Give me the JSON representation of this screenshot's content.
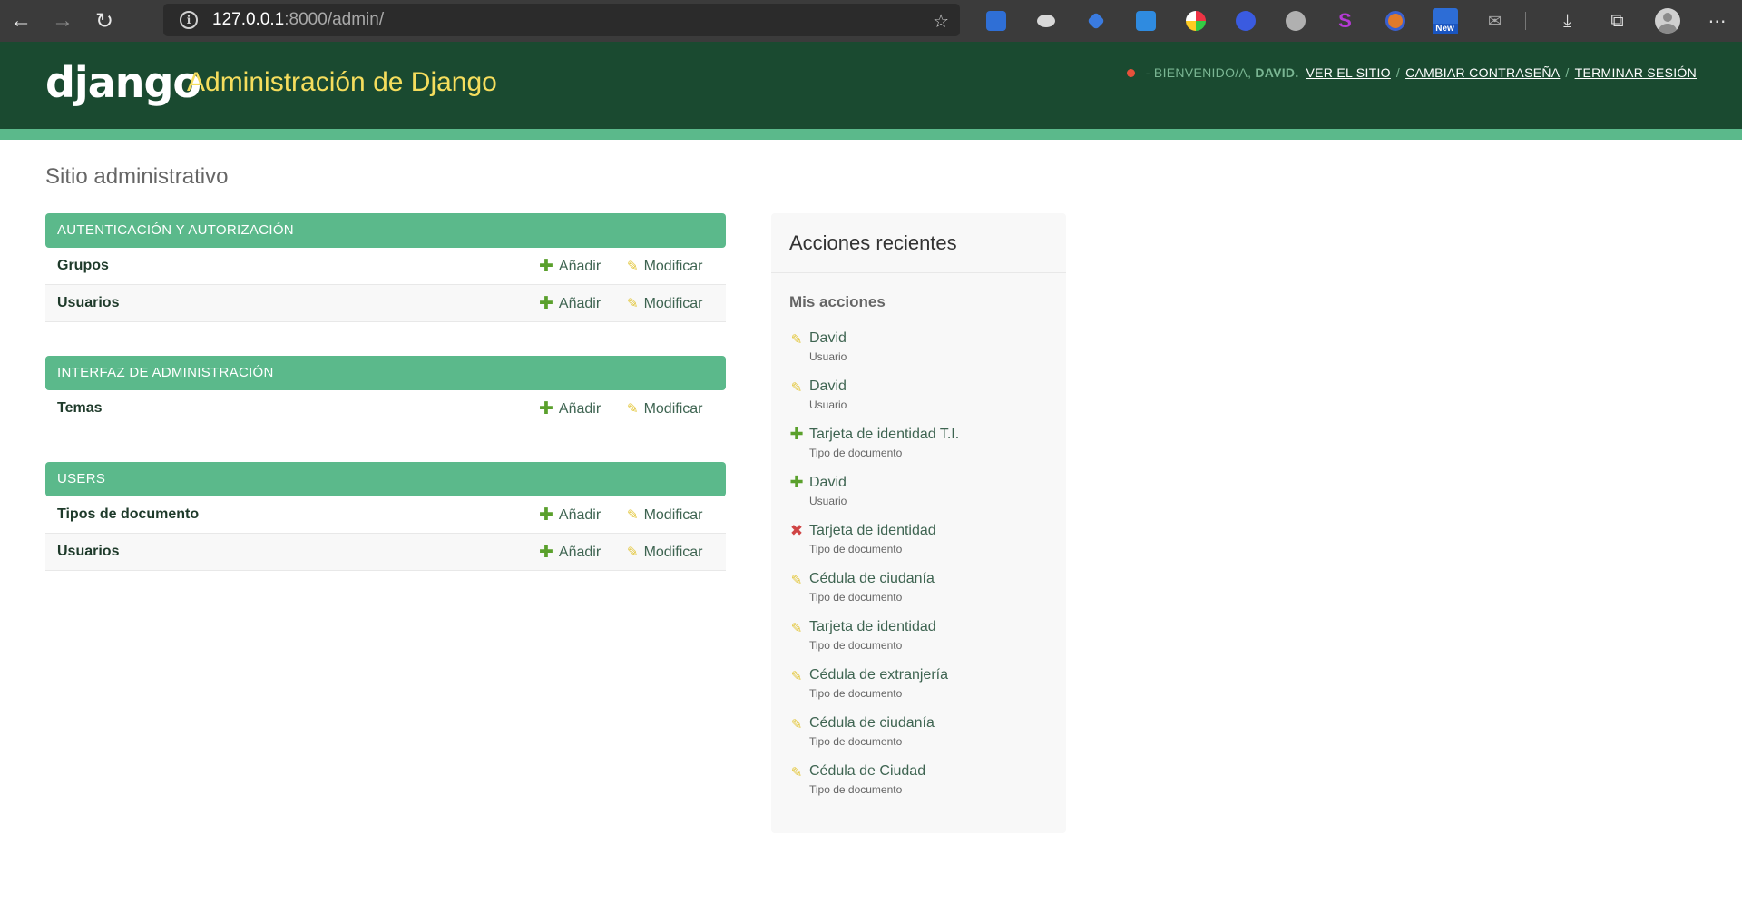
{
  "browser": {
    "back_icon": "←",
    "forward_icon": "→",
    "reload_icon": "↻",
    "url_host": "127.0.0.1",
    "url_rest": ":8000/admin/",
    "favorite_icon": "☆",
    "download_icon": "⤓",
    "collections_icon": "⧉",
    "menu_icon": "⋯",
    "new_badge": "New"
  },
  "header": {
    "logo": "django",
    "title": "Administración de Django",
    "welcome": "- BIENVENIDO/A,",
    "username": "DAVID.",
    "links": [
      "VER EL SITIO",
      "CAMBIAR CONTRASEÑA",
      "TERMINAR SESIÓN"
    ],
    "separator": "/"
  },
  "page_title": "Sitio administrativo",
  "actions_labels": {
    "add": "Añadir",
    "change": "Modificar"
  },
  "modules": [
    {
      "caption": "AUTENTICACIÓN Y AUTORIZACIÓN",
      "rows": [
        "Grupos",
        "Usuarios"
      ]
    },
    {
      "caption": "INTERFAZ DE ADMINISTRACIÓN",
      "rows": [
        "Temas"
      ]
    },
    {
      "caption": "USERS",
      "rows": [
        "Tipos de documento",
        "Usuarios"
      ]
    }
  ],
  "recent": {
    "title": "Acciones recientes",
    "subtitle": "Mis acciones",
    "items": [
      {
        "kind": "change",
        "name": "David",
        "type": "Usuario"
      },
      {
        "kind": "change",
        "name": "David",
        "type": "Usuario"
      },
      {
        "kind": "add",
        "name": "Tarjeta de identidad T.I.",
        "type": "Tipo de documento"
      },
      {
        "kind": "add",
        "name": "David",
        "type": "Usuario"
      },
      {
        "kind": "delete",
        "name": "Tarjeta de identidad",
        "type": "Tipo de documento"
      },
      {
        "kind": "change",
        "name": "Cédula de ciudanía",
        "type": "Tipo de documento"
      },
      {
        "kind": "change",
        "name": "Tarjeta de identidad",
        "type": "Tipo de documento"
      },
      {
        "kind": "change",
        "name": "Cédula de extranjería",
        "type": "Tipo de documento"
      },
      {
        "kind": "change",
        "name": "Cédula de ciudanía",
        "type": "Tipo de documento"
      },
      {
        "kind": "change",
        "name": "Cédula de Ciudad",
        "type": "Tipo de documento"
      }
    ]
  },
  "icons": {
    "plus": "✚",
    "pencil": "✎",
    "delete": "✖"
  }
}
